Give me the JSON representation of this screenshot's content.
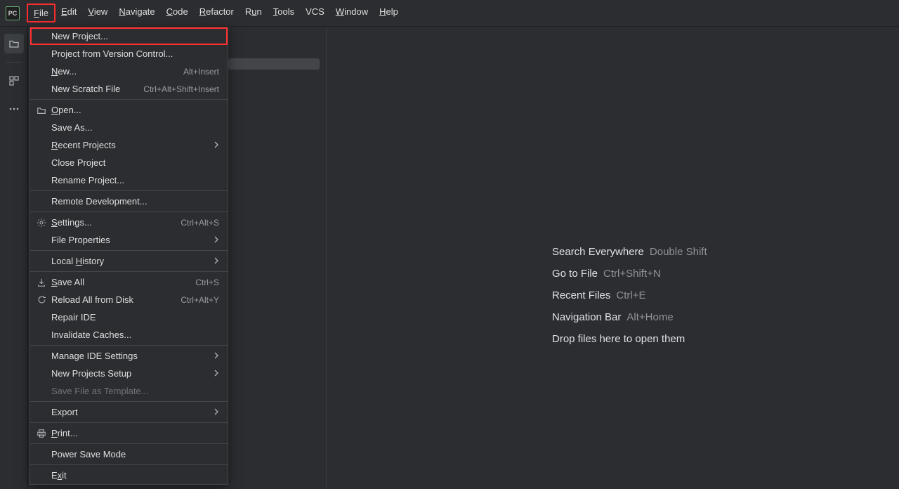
{
  "menubar": {
    "items": [
      {
        "label": "File",
        "mn": "F"
      },
      {
        "label": "Edit",
        "mn": "E"
      },
      {
        "label": "View",
        "mn": "V"
      },
      {
        "label": "Navigate",
        "mn": "N"
      },
      {
        "label": "Code",
        "mn": "C"
      },
      {
        "label": "Refactor",
        "mn": "R"
      },
      {
        "label": "Run",
        "mn": "u"
      },
      {
        "label": "Tools",
        "mn": "T"
      },
      {
        "label": "VCS",
        "mn": ""
      },
      {
        "label": "Window",
        "mn": "W"
      },
      {
        "label": "Help",
        "mn": "H"
      }
    ]
  },
  "app_logo": "PC",
  "dropdown": {
    "groups": [
      [
        {
          "label": "New Project...",
          "variant": "new-project"
        },
        {
          "label": "Project from Version Control..."
        },
        {
          "label": "New...",
          "mn": "N",
          "shortcut": "Alt+Insert"
        },
        {
          "label": "New Scratch File",
          "shortcut": "Ctrl+Alt+Shift+Insert"
        }
      ],
      [
        {
          "label": "Open...",
          "mn": "O",
          "icon": "folder"
        },
        {
          "label": "Save As..."
        },
        {
          "label": "Recent Projects",
          "mn": "R",
          "submenu": true
        },
        {
          "label": "Close Project"
        },
        {
          "label": "Rename Project..."
        }
      ],
      [
        {
          "label": "Remote Development..."
        }
      ],
      [
        {
          "label": "Settings...",
          "mn": "S",
          "icon": "gear",
          "shortcut": "Ctrl+Alt+S"
        },
        {
          "label": "File Properties",
          "submenu": true
        }
      ],
      [
        {
          "label": "Local History",
          "mn": "H",
          "submenu": true
        }
      ],
      [
        {
          "label": "Save All",
          "mn": "S",
          "icon": "save",
          "shortcut": "Ctrl+S"
        },
        {
          "label": "Reload All from Disk",
          "icon": "reload",
          "shortcut": "Ctrl+Alt+Y"
        },
        {
          "label": "Repair IDE"
        },
        {
          "label": "Invalidate Caches..."
        }
      ],
      [
        {
          "label": "Manage IDE Settings",
          "submenu": true
        },
        {
          "label": "New Projects Setup",
          "submenu": true
        },
        {
          "label": "Save File as Template...",
          "disabled": true
        }
      ],
      [
        {
          "label": "Export",
          "submenu": true
        }
      ],
      [
        {
          "label": "Print...",
          "mn": "P",
          "icon": "print"
        }
      ],
      [
        {
          "label": "Power Save Mode"
        }
      ],
      [
        {
          "label": "Exit",
          "mn": "x"
        }
      ]
    ]
  },
  "tips": [
    {
      "label": "Search Everywhere",
      "key": "Double Shift"
    },
    {
      "label": "Go to File",
      "key": "Ctrl+Shift+N"
    },
    {
      "label": "Recent Files",
      "key": "Ctrl+E"
    },
    {
      "label": "Navigation Bar",
      "key": "Alt+Home"
    },
    {
      "label": "Drop files here to open them",
      "key": ""
    }
  ]
}
